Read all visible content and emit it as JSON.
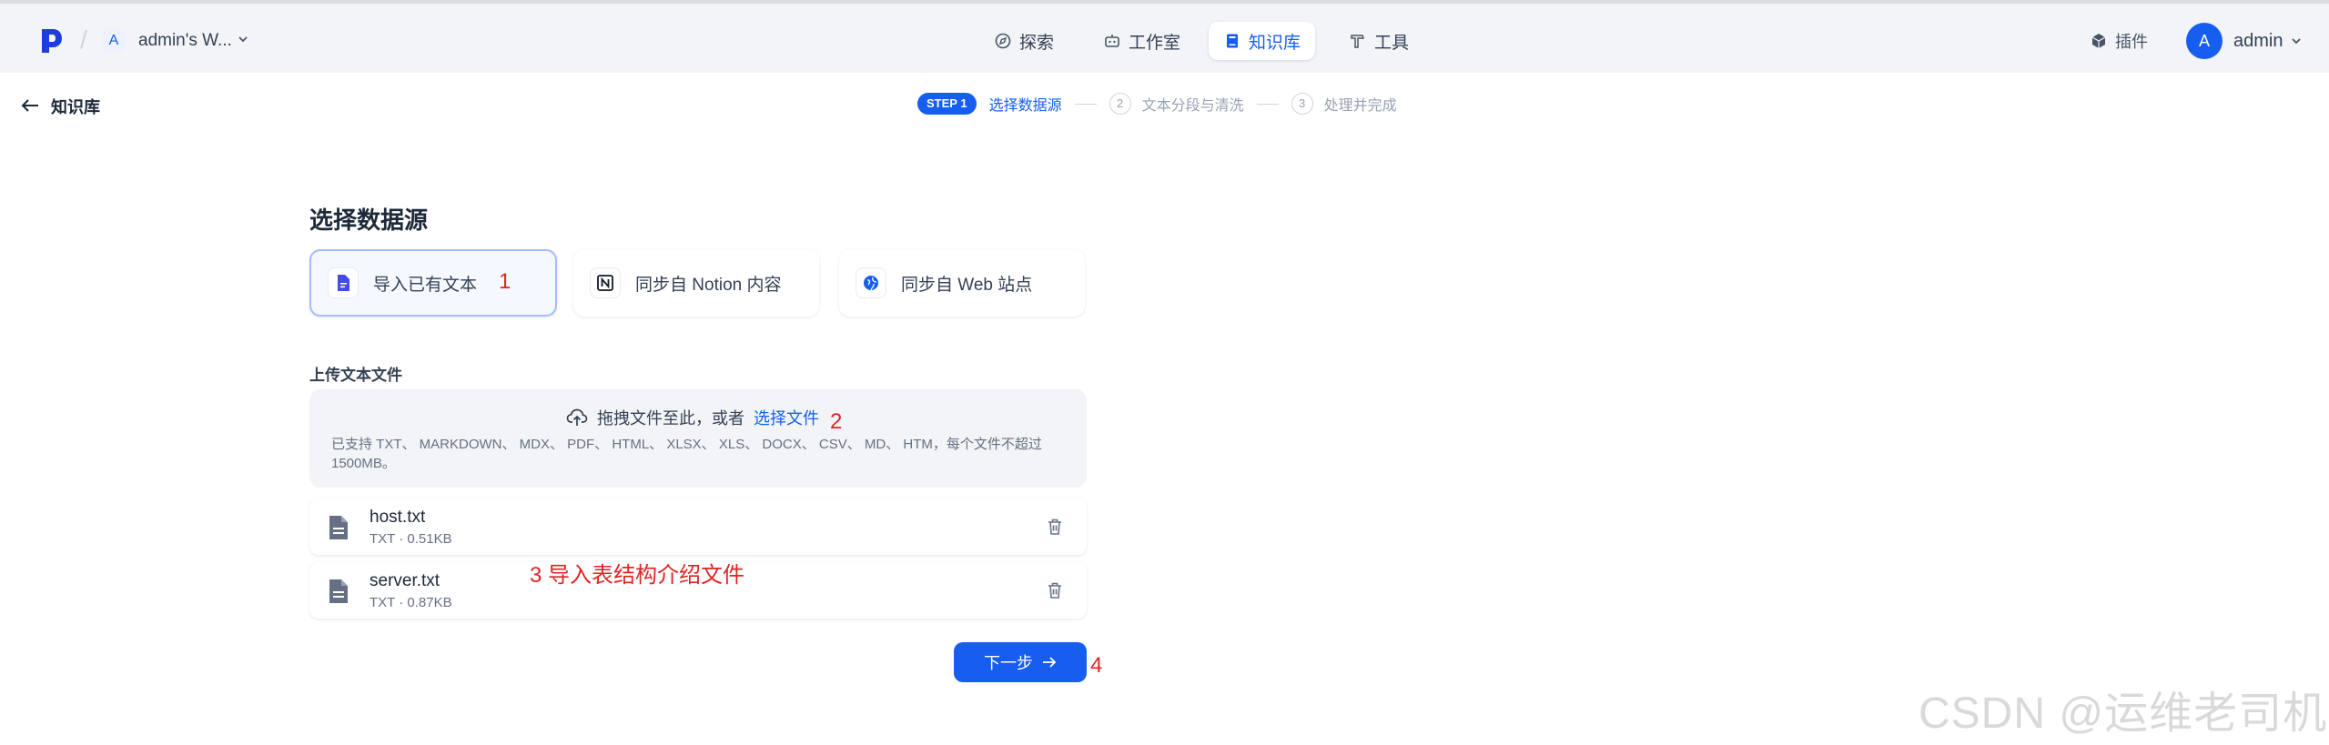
{
  "header": {
    "workspace_initial": "A",
    "workspace_name": "admin's W...",
    "nav": [
      {
        "label": "探索",
        "icon": "compass-icon",
        "active": false
      },
      {
        "label": "工作室",
        "icon": "robot-icon",
        "active": false
      },
      {
        "label": "知识库",
        "icon": "book-icon",
        "active": true
      },
      {
        "label": "工具",
        "icon": "hammer-icon",
        "active": false
      }
    ],
    "plugins_label": "插件",
    "user_initial": "A",
    "user_name": "admin"
  },
  "subheader": {
    "back_label": "知识库",
    "steps": [
      {
        "badge": "STEP 1",
        "label": "选择数据源",
        "active": true
      },
      {
        "badge": "2",
        "label": "文本分段与清洗",
        "active": false
      },
      {
        "badge": "3",
        "label": "处理并完成",
        "active": false
      }
    ]
  },
  "main": {
    "section_title": "选择数据源",
    "sources": [
      {
        "label": "导入已有文本",
        "icon": "file-text-icon",
        "selected": true
      },
      {
        "label": "同步自 Notion 内容",
        "icon": "notion-icon",
        "selected": false
      },
      {
        "label": "同步自 Web 站点",
        "icon": "globe-icon",
        "selected": false
      }
    ],
    "upload_label": "上传文本文件",
    "dropzone": {
      "prompt": "拖拽文件至此，或者",
      "link": "选择文件",
      "support": "已支持 TXT、 MARKDOWN、 MDX、 PDF、 HTML、 XLSX、 XLS、 DOCX、 CSV、 MD、 HTM，每个文件不超过 1500MB。"
    },
    "files": [
      {
        "name": "host.txt",
        "meta": "TXT · 0.51KB"
      },
      {
        "name": "server.txt",
        "meta": "TXT · 0.87KB"
      }
    ],
    "next_label": "下一步"
  },
  "annotations": {
    "a1": "1",
    "a2": "2",
    "a3": "3 导入表结构介绍文件",
    "a4": "4"
  },
  "watermark": "CSDN @运维老司机",
  "colors": {
    "primary": "#155eef",
    "annotation": "#e02424",
    "topbar": "#f2f4f7"
  }
}
